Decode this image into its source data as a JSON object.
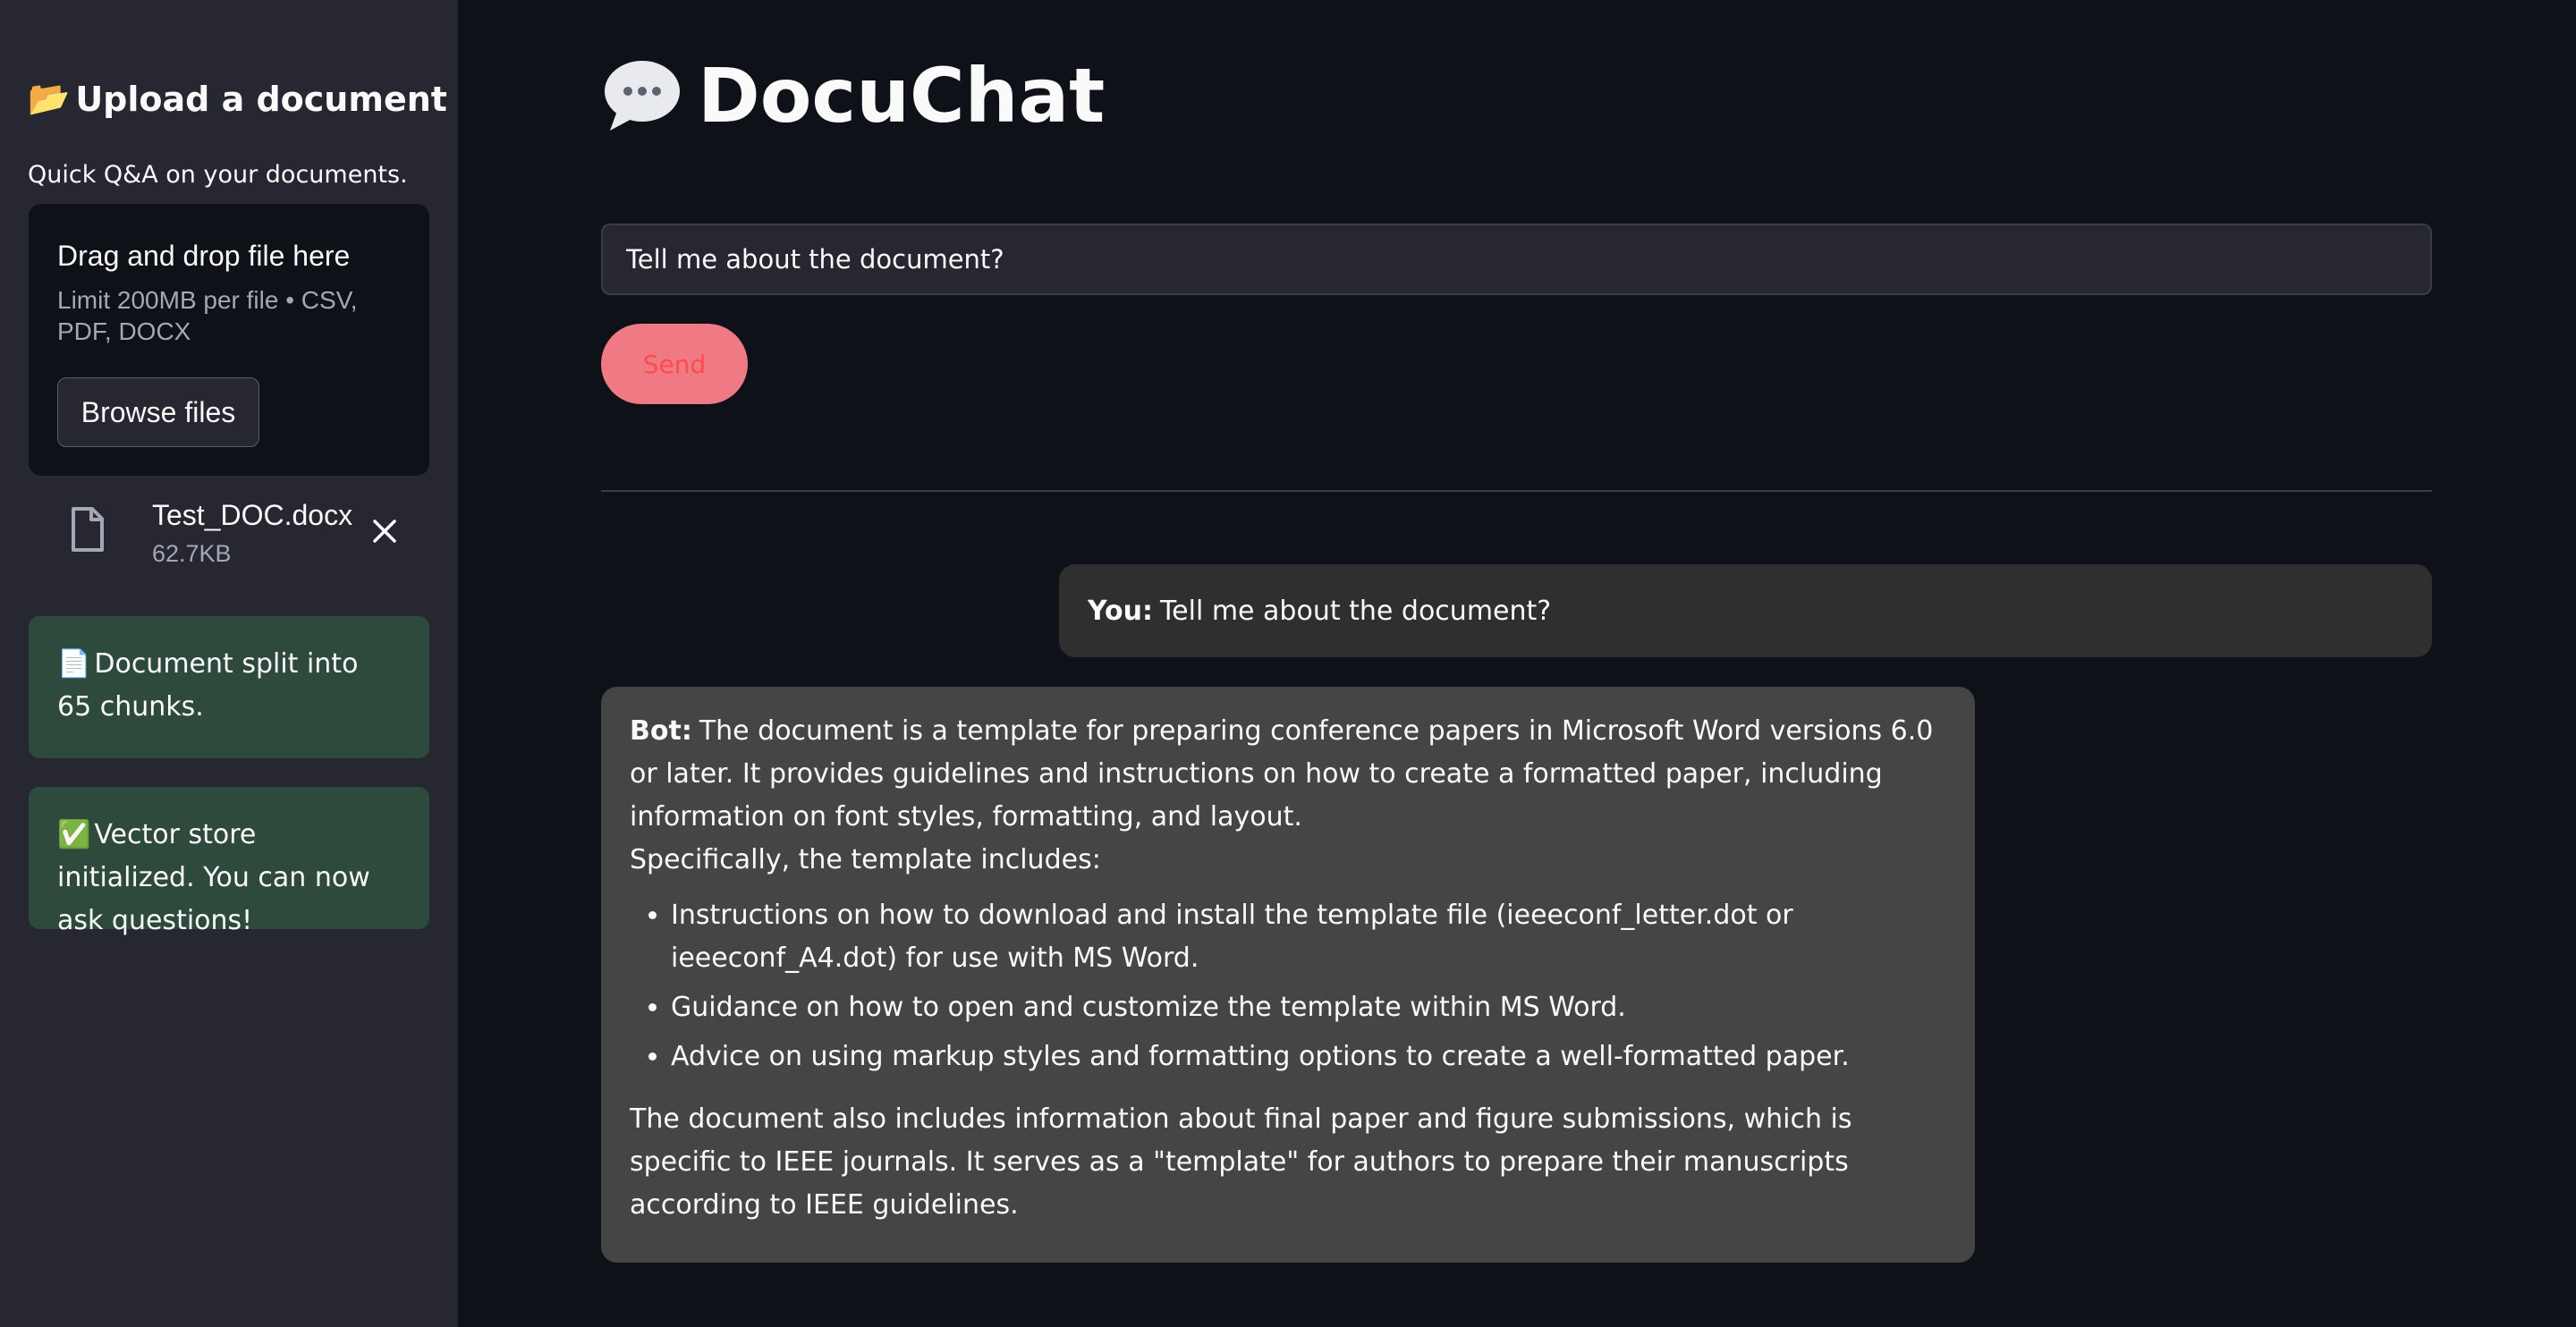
{
  "sidebar": {
    "title_icon": "📂",
    "title": "Upload a document",
    "subtitle": "Quick Q&A on your documents.",
    "dropzone": {
      "title": "Drag and drop file here",
      "limit": "Limit 200MB per file • CSV, PDF, DOCX",
      "browse_label": "Browse files"
    },
    "uploaded_file": {
      "name": "Test_DOC.docx",
      "size": "62.7KB"
    },
    "status_messages": [
      {
        "emoji": "📄",
        "text": "Document split into 65 chunks."
      },
      {
        "emoji": "✅",
        "text": "Vector store initialized. You can now ask questions!"
      }
    ]
  },
  "main": {
    "title": "DocuChat",
    "query": {
      "value": "Tell me about the document?"
    },
    "send_label": "Send",
    "chat": {
      "user": {
        "label": "You:",
        "text": "Tell me about the document?"
      },
      "bot": {
        "label": "Bot:",
        "intro": "The document is a template for preparing conference papers in Microsoft Word versions 6.0 or later. It provides guidelines and instructions on how to create a formatted paper, including information on font styles, formatting, and layout.",
        "lead": "Specifically, the template includes:",
        "items": [
          "Instructions on how to download and install the template file (ieeeconf_letter.dot or ieeeconf_A4.dot) for use with MS Word.",
          "Guidance on how to open and customize the template within MS Word.",
          "Advice on using markup styles and formatting options to create a well-formatted paper."
        ],
        "closing": "The document also includes information about final paper and figure submissions, which is specific to IEEE journals. It serves as a \"template\" for authors to prepare their manuscripts according to IEEE guidelines."
      }
    }
  },
  "colors": {
    "sidebar_bg": "#262730",
    "main_bg": "#0e1117",
    "status_bg": "#2e4a3d",
    "send_button_bg": "#f07a83",
    "send_button_text": "#ff4b4b",
    "user_bubble_bg": "#2f2f2f",
    "bot_bubble_bg": "#454545"
  }
}
